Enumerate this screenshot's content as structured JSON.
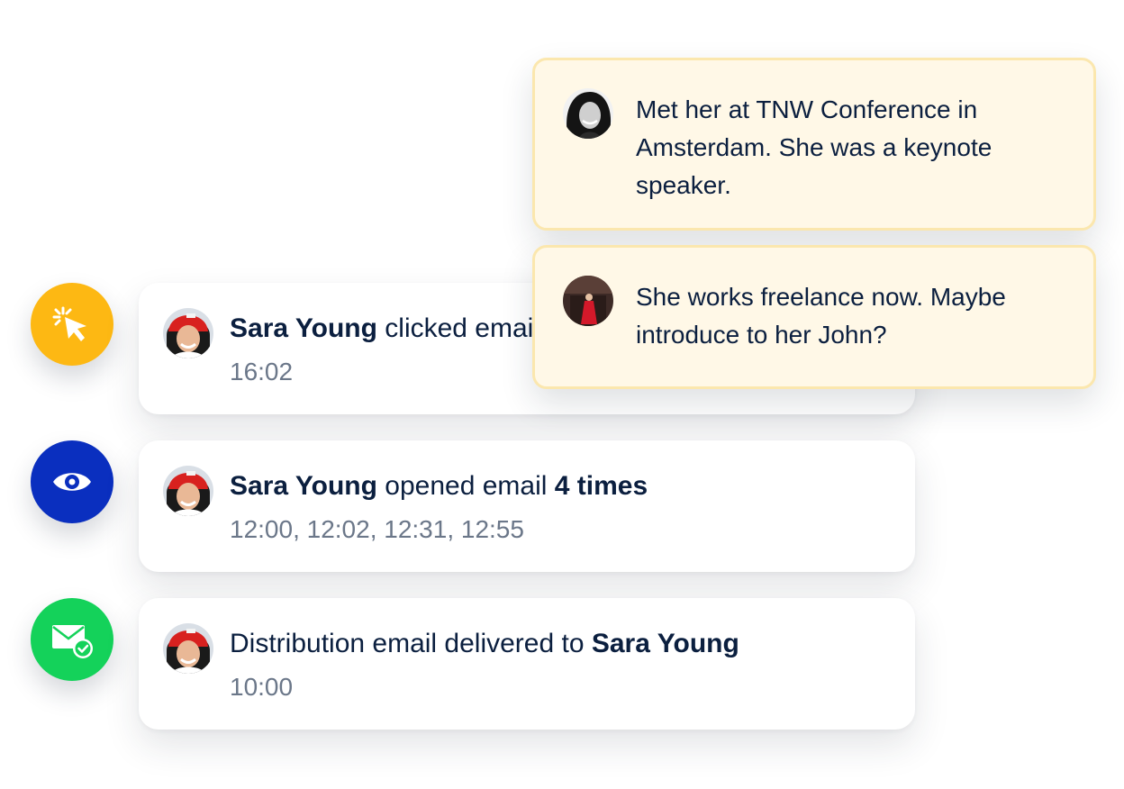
{
  "notes": [
    {
      "text": "Met her at TNW Conference in Amsterdam. She was a keynote speaker."
    },
    {
      "text": "She works freelance now. Maybe introduce to her John?"
    }
  ],
  "activities": [
    {
      "icon": "cursor-click-icon",
      "icon_color": "#fdb813",
      "prefix": "",
      "name": "Sara Young",
      "text": " clicked email ",
      "emphasis": "",
      "suffix": "",
      "time": "16:02"
    },
    {
      "icon": "eye-icon",
      "icon_color": "#0a2fbf",
      "prefix": "",
      "name": "Sara Young",
      "text": " opened email ",
      "emphasis": "4 times",
      "suffix": "",
      "time": "12:00, 12:02, 12:31, 12:55"
    },
    {
      "icon": "mail-delivered-icon",
      "icon_color": "#14d25a",
      "prefix": "Distribution email delivered to ",
      "name": "Sara Young",
      "text": "",
      "emphasis": "",
      "suffix": "",
      "time": "10:00"
    }
  ]
}
